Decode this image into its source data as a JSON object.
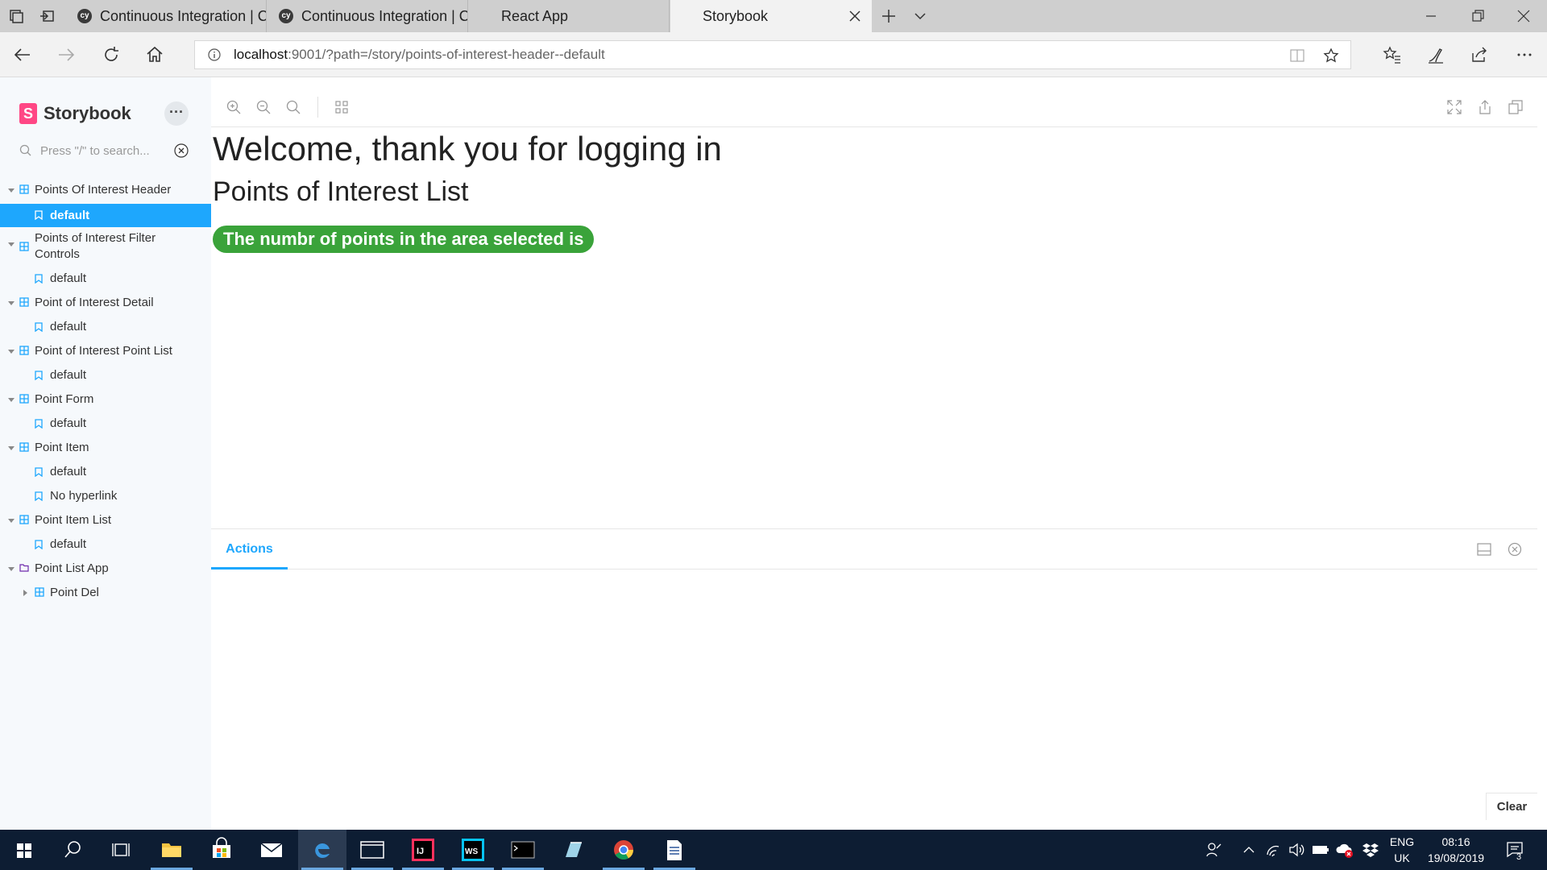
{
  "browser": {
    "tabs": [
      {
        "label": "Continuous Integration | Cy",
        "favicon": "cypress-logo",
        "active": false
      },
      {
        "label": "Continuous Integration | Cy",
        "favicon": "cypress-logo",
        "active": false
      },
      {
        "label": "React App",
        "favicon": "",
        "active": false
      },
      {
        "label": "Storybook",
        "favicon": "",
        "active": true
      }
    ],
    "url_host": "localhost",
    "url_rest": ":9001/?path=/story/points-of-interest-header--default",
    "window_controls": [
      "minimize-icon",
      "restore-icon",
      "close-icon"
    ]
  },
  "sidebar": {
    "brand": "Storybook",
    "brand_mark": "S",
    "more_label": "···",
    "search_placeholder": "Press \"/\" to search...",
    "tree": [
      {
        "kind": "component",
        "label": "Points Of Interest Header",
        "expanded": true
      },
      {
        "kind": "story",
        "label": "default",
        "selected": true
      },
      {
        "kind": "component",
        "label": "Points of Interest Filter",
        "label2": "Controls",
        "expanded": true
      },
      {
        "kind": "story",
        "label": "default"
      },
      {
        "kind": "component",
        "label": "Point of Interest Detail",
        "expanded": true
      },
      {
        "kind": "story",
        "label": "default"
      },
      {
        "kind": "component",
        "label": "Point of Interest Point List",
        "expanded": true
      },
      {
        "kind": "story",
        "label": "default"
      },
      {
        "kind": "component",
        "label": "Point Form",
        "expanded": true
      },
      {
        "kind": "story",
        "label": "default"
      },
      {
        "kind": "component",
        "label": "Point Item",
        "expanded": true
      },
      {
        "kind": "story",
        "label": "default"
      },
      {
        "kind": "story",
        "label": "No hyperlink"
      },
      {
        "kind": "component",
        "label": "Point Item List",
        "expanded": true
      },
      {
        "kind": "story",
        "label": "default"
      },
      {
        "kind": "folder",
        "label": "Point List App",
        "expanded": true
      },
      {
        "kind": "component",
        "label": "Point Del",
        "expanded": false
      }
    ]
  },
  "preview": {
    "heading": "Welcome, thank you for logging in",
    "subheading": "Points of Interest List",
    "badge": "The numbr of points in the area selected is"
  },
  "addons": {
    "tab_label": "Actions",
    "clear_label": "Clear"
  },
  "taskbar": {
    "apps": [
      "windows-start-icon",
      "search-icon",
      "task-view-icon",
      "file-explorer-icon",
      "store-icon",
      "mail-icon",
      "edge-icon",
      "window-icon",
      "intellij-icon",
      "webstorm-icon",
      "terminal-icon",
      "notes-icon",
      "chrome-icon",
      "document-icon"
    ],
    "lang_line1": "ENG",
    "lang_line2": "UK",
    "time": "08:16",
    "date": "19/08/2019",
    "notification_count": "3"
  },
  "colors": {
    "accent": "#1ea7fd",
    "storybook_pink": "#ff4785",
    "badge_green": "#3aa33a",
    "taskbar": "#0d1d33"
  }
}
